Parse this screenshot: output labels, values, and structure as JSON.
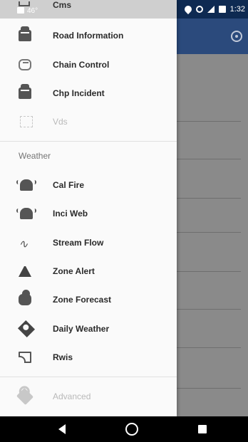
{
  "status_bar": {
    "temperature": "46°",
    "time": "1:32"
  },
  "drawer": {
    "cut_off_item": "Cms",
    "primary_items": [
      {
        "label": "Road Information",
        "icon": "car-icon",
        "enabled": true
      },
      {
        "label": "Chain Control",
        "icon": "link-icon",
        "enabled": true
      },
      {
        "label": "Chp Incident",
        "icon": "car-icon",
        "enabled": true
      },
      {
        "label": "Vds",
        "icon": "scan-icon",
        "enabled": false
      }
    ],
    "weather_section": {
      "header": "Weather",
      "items": [
        {
          "label": "Cal Fire",
          "icon": "alert-bell-icon"
        },
        {
          "label": "Inci Web",
          "icon": "alert-bell-icon"
        },
        {
          "label": "Stream Flow",
          "icon": "wave-icon"
        },
        {
          "label": "Zone Alert",
          "icon": "warning-triangle-icon"
        },
        {
          "label": "Zone Forecast",
          "icon": "cloud-icon"
        },
        {
          "label": "Daily Weather",
          "icon": "sun-icon"
        },
        {
          "label": "Rwis",
          "icon": "cast-icon"
        }
      ]
    },
    "footer_item": {
      "label": "Advanced",
      "icon": "wrench-icon",
      "enabled": false
    }
  },
  "colors": {
    "drawer_bg": "#fafafa",
    "toolbar": "#2b4a7c",
    "status_bar": "#0e2a52",
    "scrim": "#8a8a8a"
  }
}
